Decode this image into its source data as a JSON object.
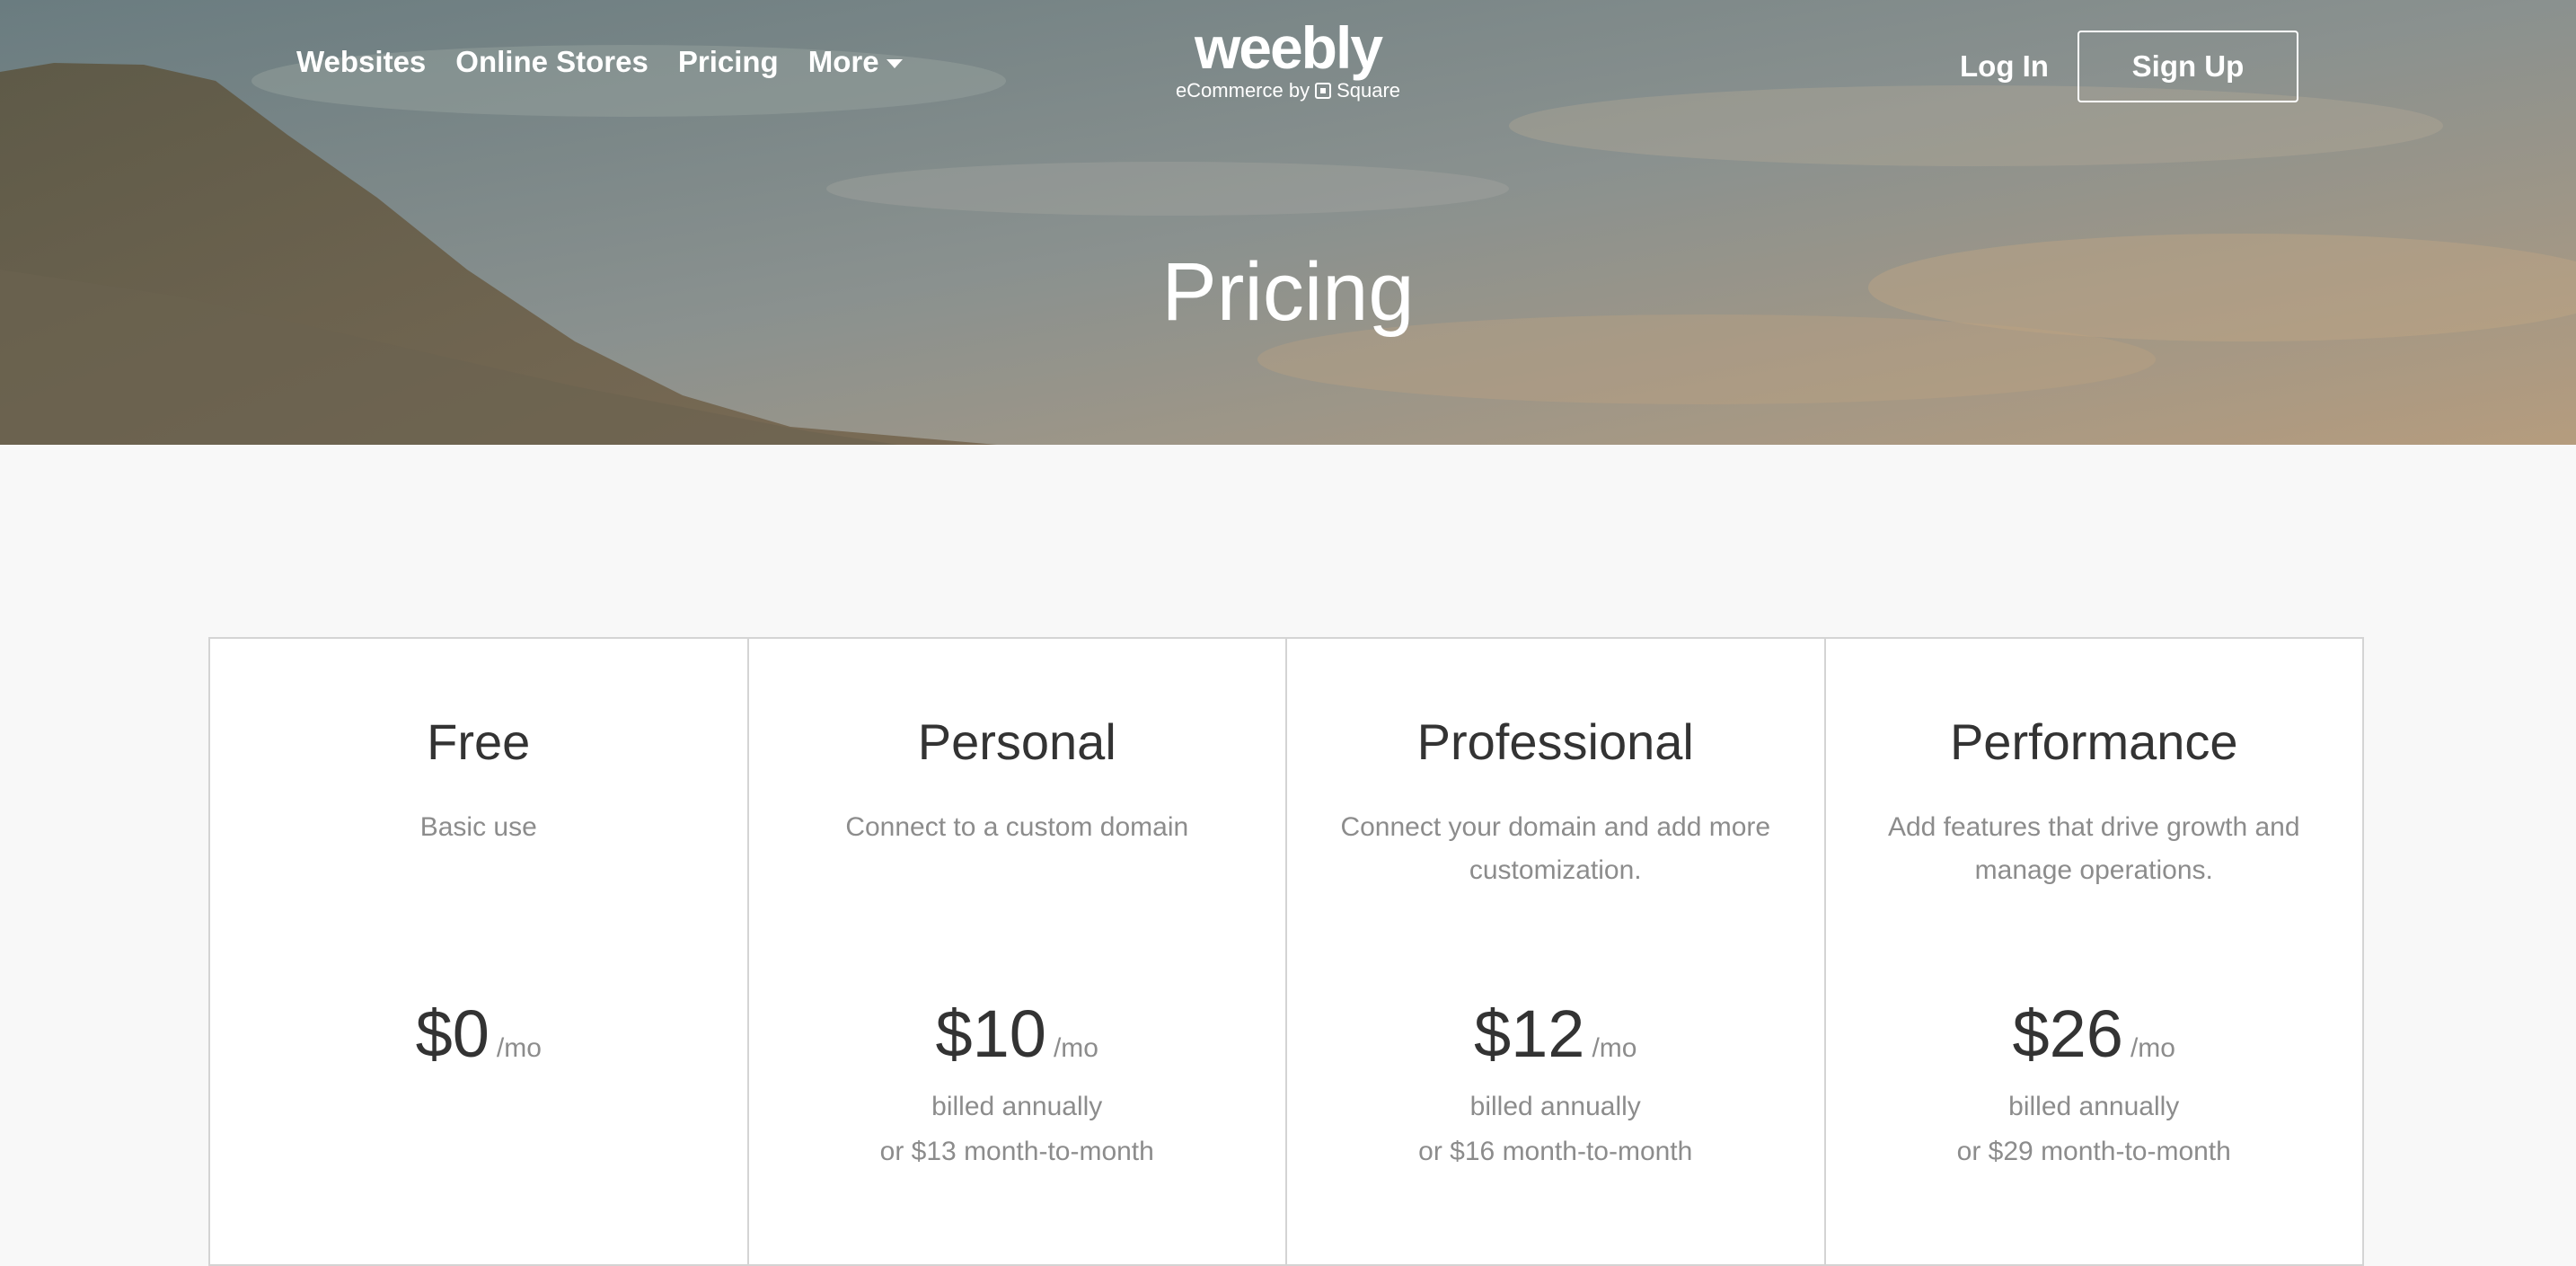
{
  "nav": {
    "items": [
      {
        "label": "Websites"
      },
      {
        "label": "Online Stores"
      },
      {
        "label": "Pricing"
      }
    ],
    "more_label": "More",
    "more_icon": "caret-down-icon"
  },
  "logo": {
    "wordmark": "weebly",
    "tagline_prefix": "eCommerce by",
    "tagline_suffix": "Square"
  },
  "auth": {
    "login_label": "Log In",
    "signup_label": "Sign Up"
  },
  "hero": {
    "title": "Pricing"
  },
  "plans": [
    {
      "name": "Free",
      "desc": "Basic use",
      "price": "$0",
      "per": "/mo",
      "billing_line1": "",
      "billing_line2": ""
    },
    {
      "name": "Personal",
      "desc": "Connect to a custom domain",
      "price": "$10",
      "per": "/mo",
      "billing_line1": "billed annually",
      "billing_line2": "or $13 month-to-month"
    },
    {
      "name": "Professional",
      "desc": "Connect your domain and add more customization.",
      "price": "$12",
      "per": "/mo",
      "billing_line1": "billed annually",
      "billing_line2": "or $16 month-to-month"
    },
    {
      "name": "Performance",
      "desc": "Add features that drive growth and manage operations.",
      "price": "$26",
      "per": "/mo",
      "billing_line1": "billed annually",
      "billing_line2": "or $29 month-to-month"
    }
  ],
  "colors": {
    "text_dark": "#333333",
    "text_muted": "#8c8c8c",
    "border": "#d4d4d4",
    "page_bg": "#f8f8f8"
  }
}
